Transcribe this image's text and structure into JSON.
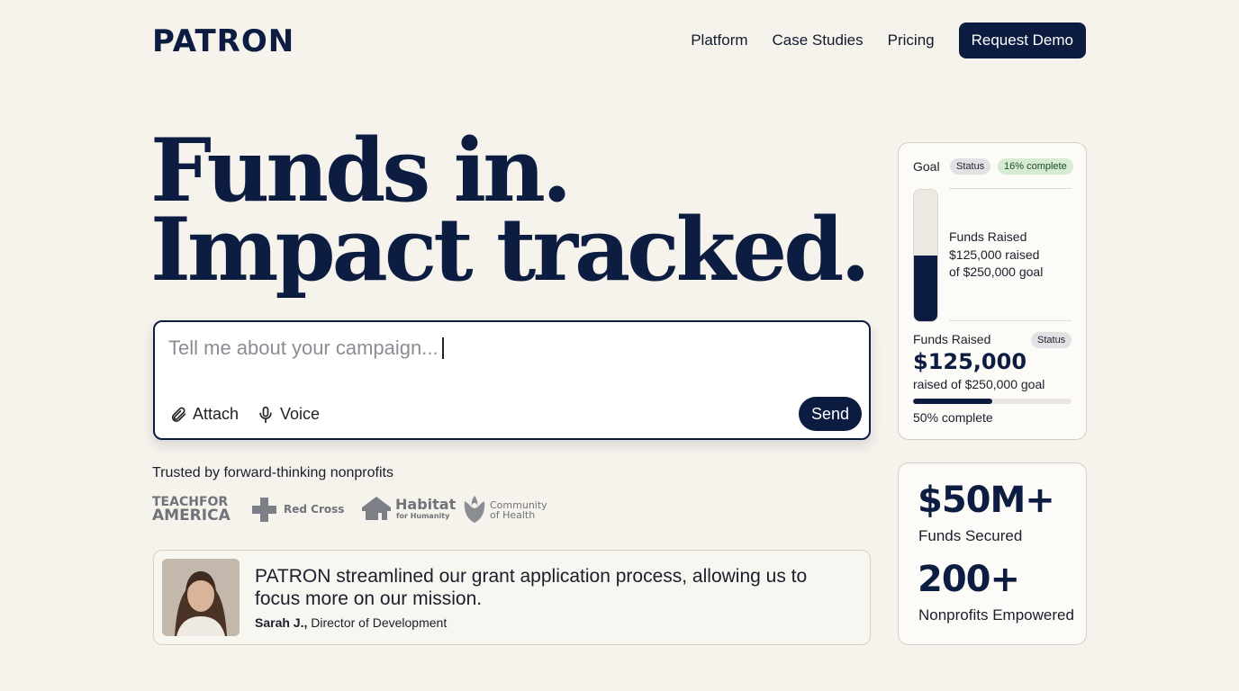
{
  "header": {
    "logo": "PATRON",
    "nav": [
      "Platform",
      "Case Studies",
      "Pricing"
    ],
    "cta": "Request Demo"
  },
  "hero": {
    "line1": "Funds in.",
    "line2": "Impact tracked."
  },
  "prompt": {
    "placeholder": "Tell me about your campaign...",
    "attach": "Attach",
    "voice": "Voice",
    "send": "Send"
  },
  "trusted": {
    "label": "Trusted by forward-thinking nonprofits",
    "logos": {
      "tfa1": "TEACHFOR",
      "tfa2": "AMERICA",
      "redcross": "Red Cross",
      "habitat1": "Habitat",
      "habitat2": "for Humanity",
      "coh1": "Community",
      "coh2": "of Health"
    }
  },
  "testimonial": {
    "quote": "PATRON streamlined our grant application process, allowing us to focus more on our mission.",
    "name": "Sarah J.,",
    "role": "Director of Development"
  },
  "goal_card": {
    "title": "Goal",
    "status_badge": "Status",
    "complete_badge": "16% complete",
    "thermo_fill_fraction": 0.5,
    "thermo_label": "Funds Raised",
    "thermo_line1": "$125,000 raised",
    "thermo_line2": "of $250,000 goal",
    "funds_label": "Funds Raised",
    "funds_status": "Status",
    "amount": "$125,000",
    "goal_text": "raised of $250,000 goal",
    "progress_fraction": 0.5,
    "progress_text": "50% complete"
  },
  "stats": [
    {
      "value": "$50M+",
      "label": "Funds Secured"
    },
    {
      "value": "200+",
      "label": "Nonprofits Empowered"
    }
  ],
  "colors": {
    "navy": "#0b1c40",
    "background": "#f6f3ec",
    "success_badge": "#d5ecd3"
  }
}
